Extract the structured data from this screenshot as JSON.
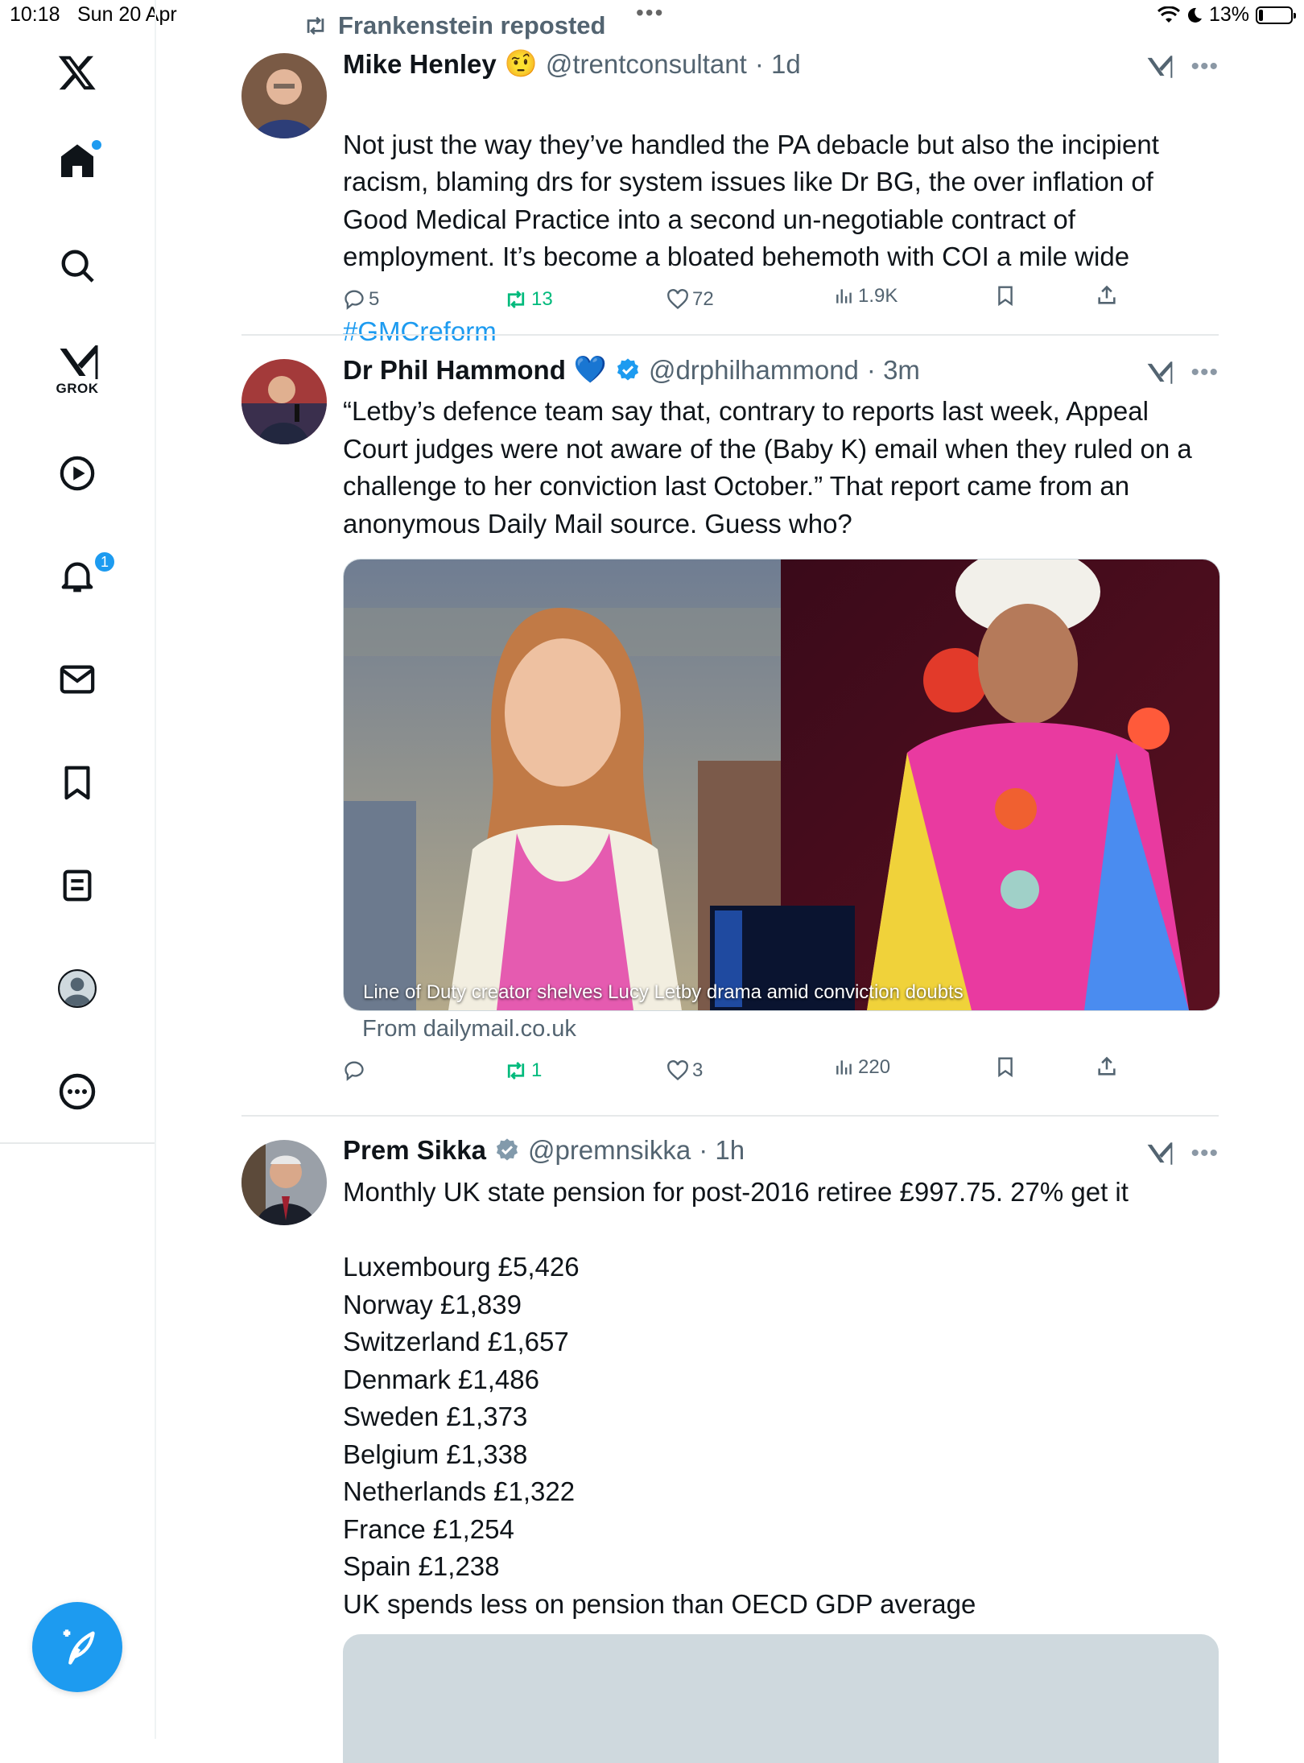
{
  "status_bar": {
    "time": "10:18",
    "date": "Sun 20 Apr",
    "battery": "13%",
    "battery_level": 0.13
  },
  "sidebar": {
    "items": [
      {
        "name": "home",
        "badge_dot": true
      },
      {
        "name": "search"
      },
      {
        "name": "grok",
        "label": "GROK"
      },
      {
        "name": "videos"
      },
      {
        "name": "notifications",
        "badge": "1"
      },
      {
        "name": "messages"
      },
      {
        "name": "bookmarks"
      },
      {
        "name": "lists"
      },
      {
        "name": "profile"
      },
      {
        "name": "more"
      }
    ],
    "compose_icon": "compose-icon",
    "accent_color": "#1d9bf0"
  },
  "repost": {
    "text": "Frankenstein reposted"
  },
  "tweets": [
    {
      "name": "Mike Henley",
      "emoji": "🤨",
      "handle": "@trentconsultant",
      "time": "· 1d",
      "text": "Not just the way they’ve handled the PA debacle but also the incipient racism, blaming drs for system issues like Dr BG, the over inflation of Good Medical Practice into a second un-negotiable contract of employment. It’s become a bloated behemoth with COI a mile wide",
      "hashtag": "#GMCreform",
      "replies": "5",
      "reposts": "13",
      "likes": "72",
      "views": "1.9K"
    },
    {
      "name": "Dr Phil Hammond",
      "emoji": "💙",
      "handle": "@drphilhammond",
      "time": "· 3m",
      "text": "“Letby’s defence team say that, contrary to reports last week, Appeal Court judges were not aware of the (Baby K) email when they ruled on a challenge to her conviction last October.” That report came from an anonymous Daily Mail source. Guess who?",
      "card_caption": "Line of Duty creator shelves Lucy Letby drama amid conviction doubts",
      "card_source": "From dailymail.co.uk",
      "replies": "",
      "reposts": "1",
      "likes": "3",
      "views": "220"
    },
    {
      "name": "Prem Sikka",
      "handle": "@premnsikka",
      "time": "· 1h",
      "text": "Monthly UK state pension for post-2016 retiree £997.75. 27% get it\n\nLuxembourg £5,426\nNorway £1,839\nSwitzerland £1,657\nDenmark £1,486\nSweden £1,373\nBelgium £1,338\nNetherlands £1,322\nFrance £1,254\nSpain £1,238\nUK spends less on pension than OECD GDP average"
    }
  ]
}
